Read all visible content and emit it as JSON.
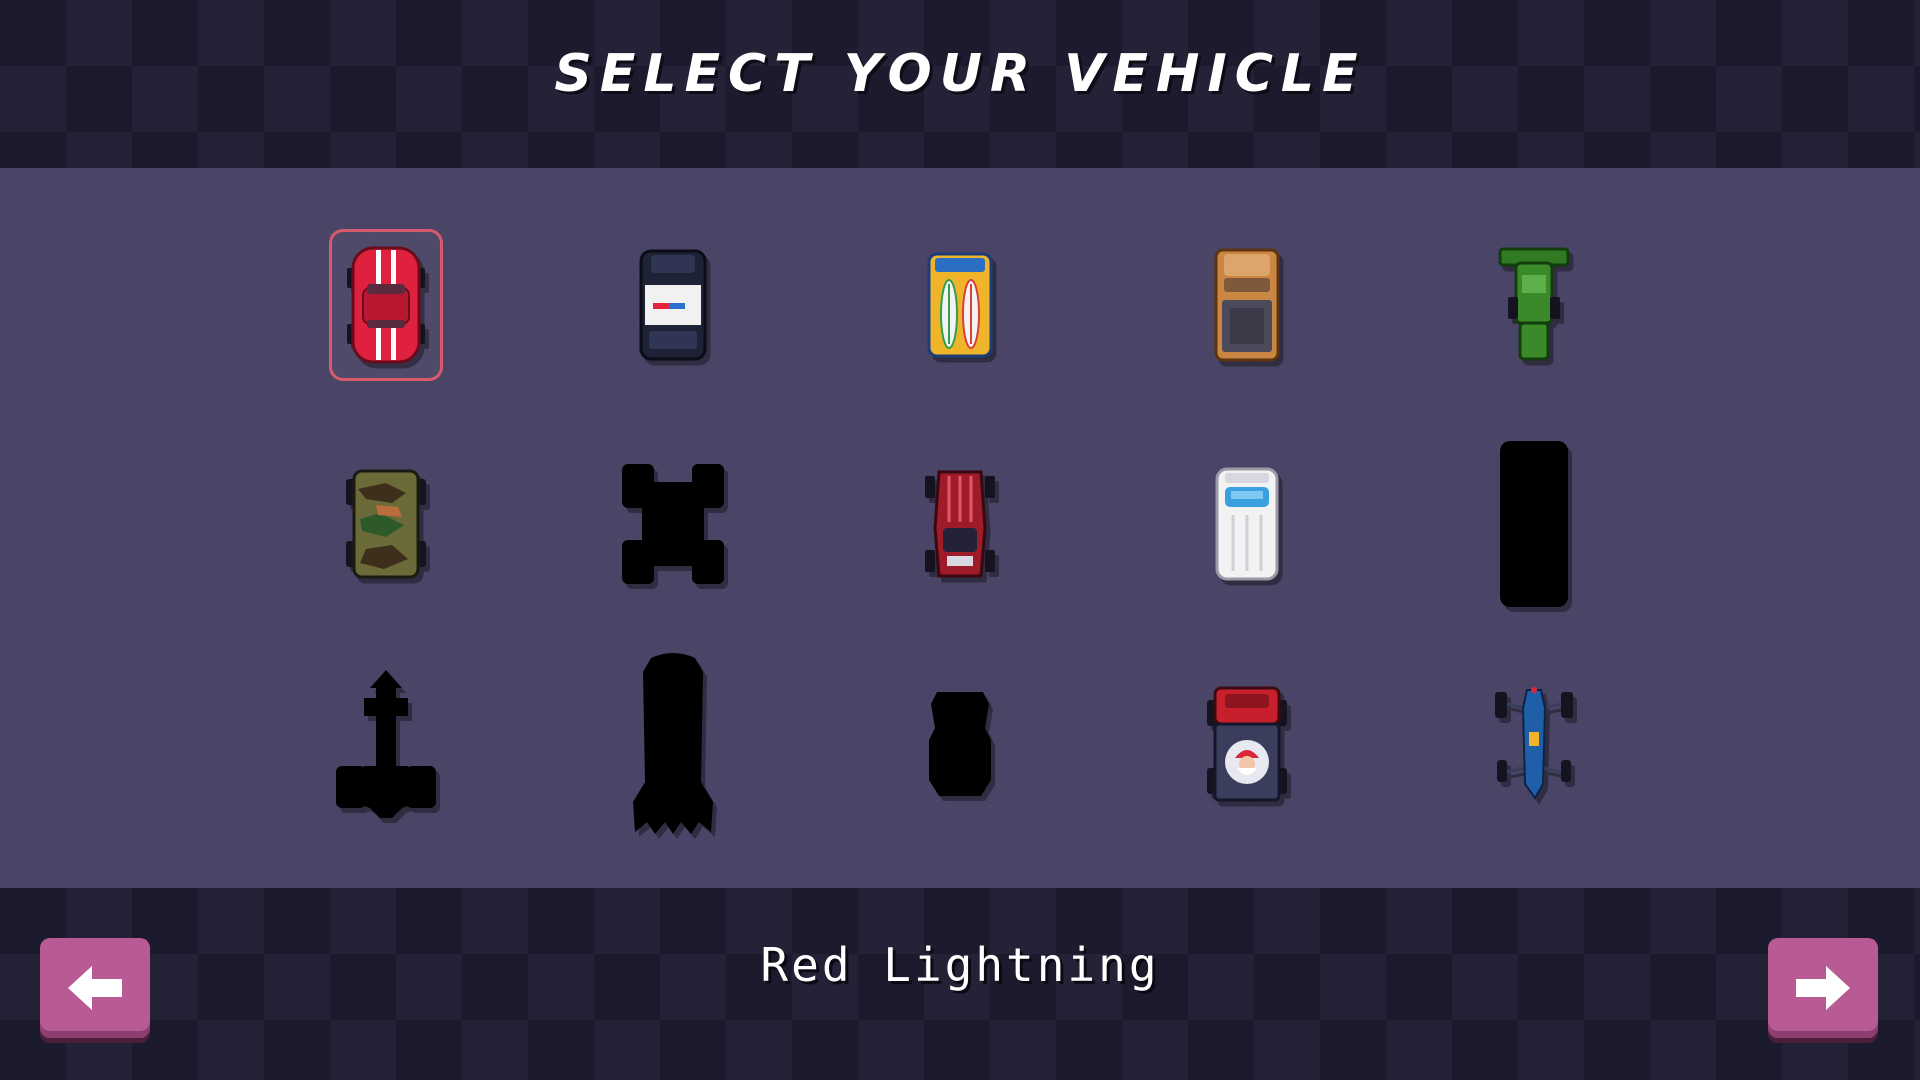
{
  "header": {
    "title": "SELECT YOUR VEHICLE"
  },
  "selected_vehicle_name": "Red Lightning",
  "selected_index": 0,
  "vehicles": [
    {
      "row": 1,
      "col": 1,
      "kind": "muscle-car",
      "unlocked": true,
      "color": "#e0203f"
    },
    {
      "row": 1,
      "col": 2,
      "kind": "police-car",
      "unlocked": true,
      "color": "#1e2236"
    },
    {
      "row": 1,
      "col": 3,
      "kind": "surf-van",
      "unlocked": true,
      "color": "#2a6fc4"
    },
    {
      "row": 1,
      "col": 4,
      "kind": "pickup-truck",
      "unlocked": true,
      "color": "#c98743"
    },
    {
      "row": 1,
      "col": 5,
      "kind": "harvester",
      "unlocked": true,
      "color": "#3a8a2a"
    },
    {
      "row": 2,
      "col": 1,
      "kind": "camo-jeep",
      "unlocked": true,
      "color": "#6b6b3a"
    },
    {
      "row": 2,
      "col": 2,
      "kind": "monster-truck",
      "unlocked": false,
      "color": "#000000"
    },
    {
      "row": 2,
      "col": 3,
      "kind": "hot-rod",
      "unlocked": true,
      "color": "#9e1c2a"
    },
    {
      "row": 2,
      "col": 4,
      "kind": "ambulance",
      "unlocked": true,
      "color": "#f2f2f2"
    },
    {
      "row": 2,
      "col": 5,
      "kind": "bus",
      "unlocked": false,
      "color": "#000000"
    },
    {
      "row": 3,
      "col": 1,
      "kind": "rocket",
      "unlocked": false,
      "color": "#000000"
    },
    {
      "row": 3,
      "col": 2,
      "kind": "shuttle",
      "unlocked": false,
      "color": "#000000"
    },
    {
      "row": 3,
      "col": 3,
      "kind": "buggy",
      "unlocked": false,
      "color": "#000000"
    },
    {
      "row": 3,
      "col": 4,
      "kind": "santa-truck",
      "unlocked": true,
      "color": "#c7202c"
    },
    {
      "row": 3,
      "col": 5,
      "kind": "dragster",
      "unlocked": true,
      "color": "#1e5fa8"
    }
  ],
  "controls": {
    "prev_icon": "arrow-left-icon",
    "next_icon": "arrow-right-icon"
  },
  "colors": {
    "accent": "#b85a93",
    "selection": "#d65b6c",
    "panel": "#4a4566"
  }
}
